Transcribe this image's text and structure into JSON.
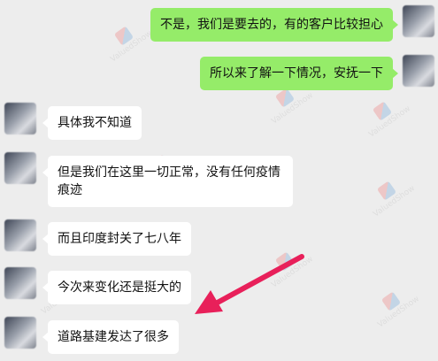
{
  "watermark": {
    "text": "ValuedShow"
  },
  "messages": [
    {
      "side": "me",
      "text": "不是，我们是要去的，有的客户比较担心"
    },
    {
      "side": "me",
      "text": "所以来了解一下情况，安抚一下"
    },
    {
      "side": "other",
      "text": "具体我不知道"
    },
    {
      "side": "other",
      "text": "但是我们在这里一切正常，没有任何疫情痕迹"
    },
    {
      "side": "other",
      "text": "而且印度封关了七八年"
    },
    {
      "side": "other",
      "text": "今次来变化还是挺大的"
    },
    {
      "side": "other",
      "text": "道路基建发达了很多"
    }
  ],
  "annotation": {
    "color": "#e8205a"
  }
}
